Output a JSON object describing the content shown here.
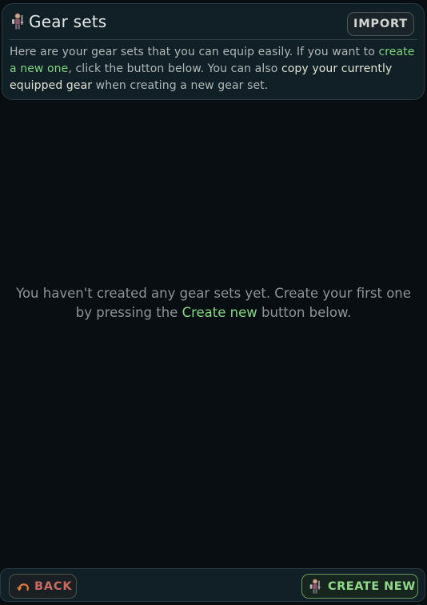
{
  "header": {
    "icon": "knight-armor-icon",
    "title": "Gear sets",
    "import_label": "IMPORT",
    "intro": {
      "part1": "Here are your gear sets that you can equip easily. If you want to ",
      "link1": "create a new one",
      "part2": ", click the button below. You can also ",
      "strong1": "copy your currently equipped gear",
      "part3": " when creating a new gear set."
    }
  },
  "empty_state": {
    "part1": "You haven't created any gear sets yet. Create your first one by pressing the ",
    "link": "Create new",
    "part2": " button below."
  },
  "footer": {
    "back_icon": "undo-arrow-icon",
    "back_label": "BACK",
    "create_icon": "knight-armor-icon",
    "create_label": "CREATE NEW"
  },
  "colors": {
    "background": "#090e12",
    "panel": "#111f26",
    "accent_green": "#7fd67f",
    "back_red": "#c96a62"
  }
}
